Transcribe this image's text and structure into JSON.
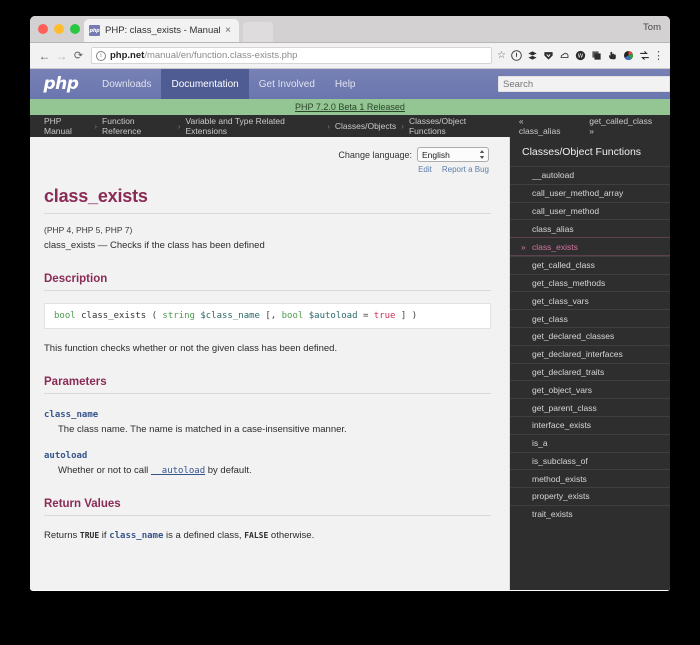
{
  "browser": {
    "tab": {
      "title": "PHP: class_exists - Manual",
      "favicon_text": "php",
      "close_label": "×"
    },
    "new_tab_label": "",
    "profile_name": "Tom",
    "nav": {
      "back": "←",
      "forward": "→",
      "reload": "⟳"
    },
    "omnibox": {
      "info_icon": "i",
      "url_domain": "php.net",
      "url_path": "/manual/en/function.class-exists.php",
      "star": "☆"
    },
    "extension_icons": [
      "shield-icon",
      "layers-icon",
      "shield-down-icon",
      "cloud-icon",
      "wiki-icon",
      "copy-icon",
      "hand-icon",
      "color-wheel-icon",
      "sync-icon"
    ],
    "menu_icon": "⋮"
  },
  "site_nav": {
    "logo": "php",
    "items": [
      {
        "label": "Downloads",
        "active": false
      },
      {
        "label": "Documentation",
        "active": true
      },
      {
        "label": "Get Involved",
        "active": false
      },
      {
        "label": "Help",
        "active": false
      }
    ],
    "search_placeholder": "Search"
  },
  "announcement": {
    "text": "PHP 7.2.0 Beta 1 Released"
  },
  "breadcrumb": {
    "items": [
      "PHP Manual",
      "Function Reference",
      "Variable and Type Related Extensions",
      "Classes/Objects",
      "Classes/Object Functions"
    ],
    "separator": "›",
    "prev": "« class_alias",
    "next": "get_called_class »"
  },
  "toolbar": {
    "change_language_label": "Change language:",
    "language_value": "English",
    "edit_label": "Edit",
    "report_label": "Report a Bug"
  },
  "main": {
    "title": "class_exists",
    "versions": "(PHP 4, PHP 5, PHP 7)",
    "purpose": "class_exists — Checks if the class has been defined",
    "description_heading": "Description",
    "signature": {
      "return_type": "bool",
      "function_name": "class_exists",
      "open_paren": "(",
      "param1_type": "string",
      "param1_name": "$class_name",
      "optional_open": "[,",
      "param2_type": "bool",
      "param2_name": "$autoload",
      "equals": "=",
      "param2_default": "true",
      "optional_close": "]",
      "close_paren": ")"
    },
    "description_text": "This function checks whether or not the given class has been defined.",
    "parameters_heading": "Parameters",
    "parameters": [
      {
        "name": "class_name",
        "desc_before": "The class name. The name is matched in a case-insensitive manner.",
        "link": "",
        "desc_after": ""
      },
      {
        "name": "autoload",
        "desc_before": "Whether or not to call ",
        "link": "__autoload",
        "desc_after": " by default."
      }
    ],
    "return_heading": "Return Values",
    "return_text": {
      "part1": "Returns ",
      "true_const": "TRUE",
      "part2": " if ",
      "param": "class_name",
      "part3": " is a defined class, ",
      "false_const": "FALSE",
      "part4": " otherwise."
    }
  },
  "sidebar": {
    "title": "Classes/Object Functions",
    "items": [
      {
        "label": "__autoload",
        "current": false
      },
      {
        "label": "call_user_method_array",
        "current": false
      },
      {
        "label": "call_user_method",
        "current": false
      },
      {
        "label": "class_alias",
        "current": false
      },
      {
        "label": "class_exists",
        "current": true
      },
      {
        "label": "get_called_class",
        "current": false
      },
      {
        "label": "get_class_methods",
        "current": false
      },
      {
        "label": "get_class_vars",
        "current": false
      },
      {
        "label": "get_class",
        "current": false
      },
      {
        "label": "get_declared_classes",
        "current": false
      },
      {
        "label": "get_declared_interfaces",
        "current": false
      },
      {
        "label": "get_declared_traits",
        "current": false
      },
      {
        "label": "get_object_vars",
        "current": false
      },
      {
        "label": "get_parent_class",
        "current": false
      },
      {
        "label": "interface_exists",
        "current": false
      },
      {
        "label": "is_a",
        "current": false
      },
      {
        "label": "is_subclass_of",
        "current": false
      },
      {
        "label": "method_exists",
        "current": false
      },
      {
        "label": "property_exists",
        "current": false
      },
      {
        "label": "trait_exists",
        "current": false
      }
    ]
  },
  "colors": {
    "php_nav": "#6d79b1",
    "php_nav_active": "#4f5b93",
    "announce_bg": "#93c693",
    "heading": "#8a2b56",
    "sidebar_bg": "#2e2e2e",
    "current_item": "#d2749f",
    "link": "#36558c"
  }
}
